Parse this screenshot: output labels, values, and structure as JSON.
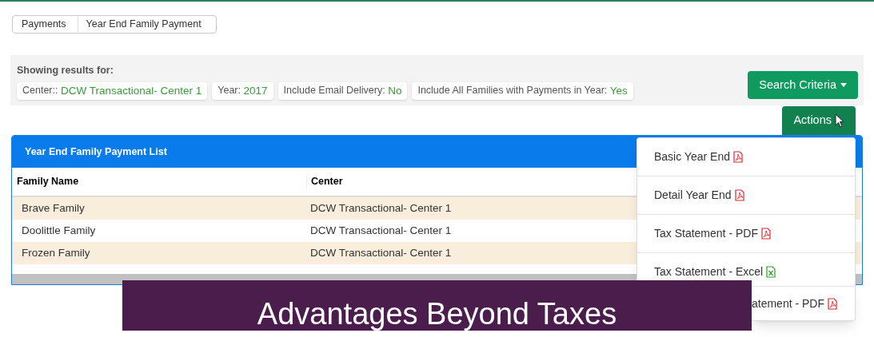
{
  "breadcrumbs": [
    "Payments",
    "Year End Family Payment"
  ],
  "filters": {
    "heading": "Showing results for:",
    "chips": [
      {
        "label": "Center::",
        "value": "DCW Transactional- Center 1"
      },
      {
        "label": "Year:",
        "value": "2017"
      },
      {
        "label": "Include Email Delivery:",
        "value": "No"
      },
      {
        "label": "Include All Families with Payments in Year:",
        "value": "Yes"
      }
    ]
  },
  "buttons": {
    "search_criteria": "Search Criteria",
    "actions": "Actions"
  },
  "table": {
    "title": "Year End Family Payment List",
    "columns": [
      "Family Name",
      "Center"
    ],
    "rows": [
      {
        "cells": [
          "Brave Family",
          "DCW Transactional- Center 1"
        ],
        "highlighted": true
      },
      {
        "cells": [
          "Doolittle Family",
          "DCW Transactional- Center 1"
        ],
        "highlighted": false
      },
      {
        "cells": [
          "Frozen Family",
          "DCW Transactional- Center 1"
        ],
        "highlighted": true
      }
    ]
  },
  "actions_menu": [
    {
      "label": "Basic Year End",
      "kind": "pdf"
    },
    {
      "label": "Detail Year End",
      "kind": "pdf"
    },
    {
      "label": "Tax Statement - PDF",
      "kind": "pdf"
    },
    {
      "label": "Tax Statement - Excel",
      "kind": "excel"
    },
    {
      "label": "atement - PDF",
      "kind": "pdf"
    }
  ],
  "banner": "Advantages Beyond Taxes"
}
